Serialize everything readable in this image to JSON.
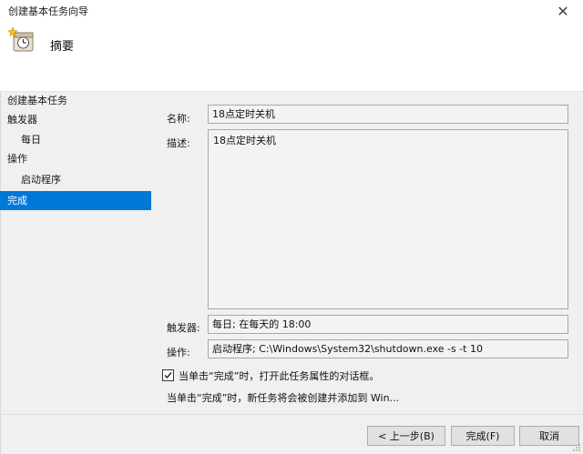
{
  "window": {
    "title": "创建基本任务向导",
    "close_glyph": "✕"
  },
  "header": {
    "title": "摘要",
    "icon": "task-scheduler-clock-icon"
  },
  "nav": {
    "items": [
      {
        "label": "创建基本任务",
        "level": 0,
        "selected": false
      },
      {
        "label": "触发器",
        "level": 0,
        "selected": false
      },
      {
        "label": "每日",
        "level": 1,
        "selected": false
      },
      {
        "label": "操作",
        "level": 0,
        "selected": false
      },
      {
        "label": "启动程序",
        "level": 1,
        "selected": false
      },
      {
        "label": "完成",
        "level": 0,
        "selected": true
      }
    ]
  },
  "summary": {
    "name_label": "名称:",
    "name_value": "18点定时关机",
    "description_label": "描述:",
    "description_value": "18点定时关机",
    "trigger_label": "触发器:",
    "trigger_value": "每日; 在每天的 18:00",
    "action_label": "操作:",
    "action_value": "启动程序; C:\\Windows\\System32\\shutdown.exe -s -t 10"
  },
  "options": {
    "open_properties_checked": true,
    "open_properties_label": "当单击“完成”时，打开此任务属性的对话框。",
    "note": "当单击“完成”时，新任务将会被创建并添加到 Win..."
  },
  "buttons": {
    "back": "< 上一步(B)",
    "finish": "完成(F)",
    "cancel": "取消"
  },
  "colors": {
    "selection": "#0078d7",
    "window_bg": "#f0f0f0",
    "header_bg": "#ffffff"
  }
}
